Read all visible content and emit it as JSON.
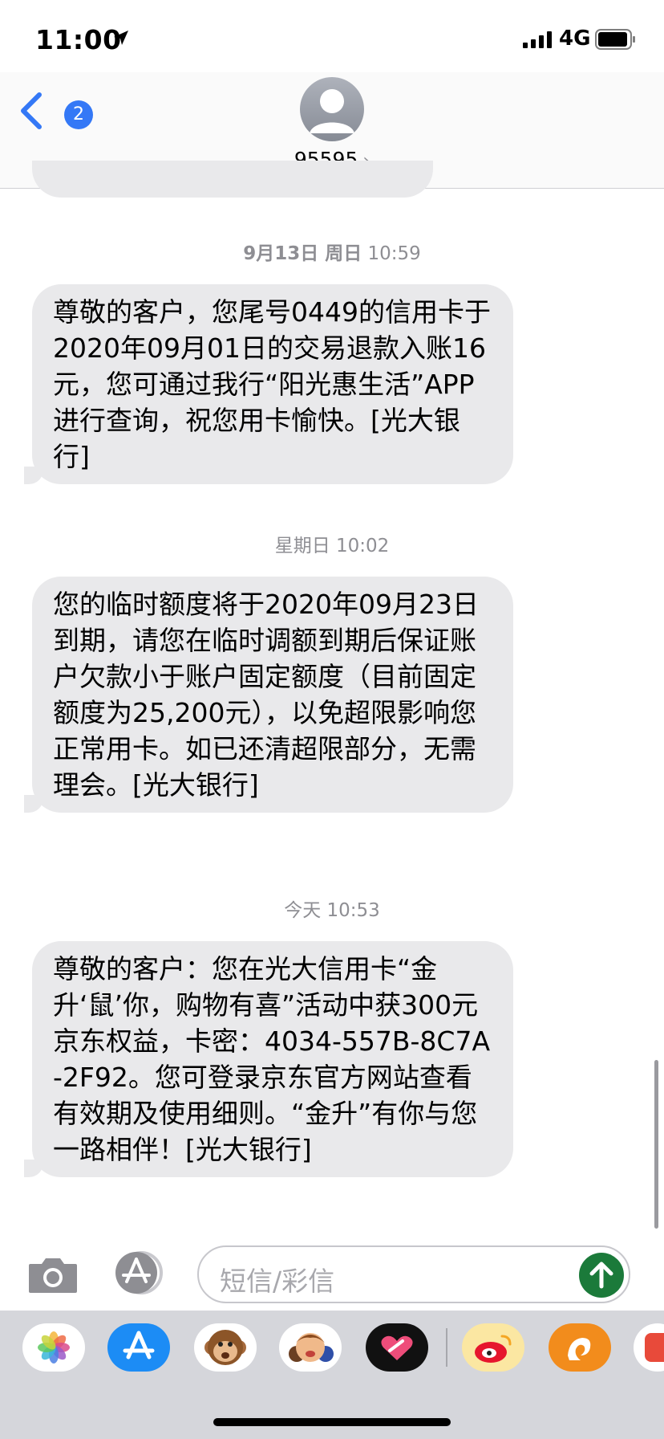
{
  "status_bar": {
    "time": "11:00",
    "network": "4G"
  },
  "header": {
    "back_count": "2",
    "contact": "95595",
    "chevron": "›"
  },
  "messages": [
    {
      "stamp_bold": "9月13日 周日",
      "stamp_time": " 10:59",
      "text": "尊敬的客户，您尾号0449的信用卡于2020年09月01日的交易退款入账16元，您可通过我行“阳光惠生活”APP进行查询，祝您用卡愉快。[光大银行]"
    },
    {
      "stamp_bold": "",
      "stamp_time": "星期日 10:02",
      "text": "您的临时额度将于2020年09月23日到期，请您在临时调额到期后保证账户欠款小于账户固定额度（目前固定额度为25,200元），以免超限影响您正常用卡。如已还清超限部分，无需理会。[光大银行]"
    },
    {
      "stamp_bold": "",
      "stamp_time": "今天 10:53",
      "text": "尊敬的客户：您在光大信用卡“金升‘鼠’你，购物有喜”活动中获300元京东权益，卡密：4034-557B-8C7A-2F92。您可登录京东官方网站查看有效期及使用细则。“金升”有你与您一路相伴！[光大银行]"
    }
  ],
  "input": {
    "placeholder": "短信/彩信"
  },
  "drawer": {
    "apps": [
      "photos-icon",
      "app-store-icon",
      "monkey-memoji-icon",
      "memoji-icon",
      "digital-touch-icon",
      "weibo-icon",
      "uc-browser-icon",
      "partial-app-icon"
    ]
  },
  "colors": {
    "bubble": "#e9e9eb",
    "accent": "#3478f6",
    "send": "#1b7a3a",
    "timestamp": "#8e8e93"
  }
}
